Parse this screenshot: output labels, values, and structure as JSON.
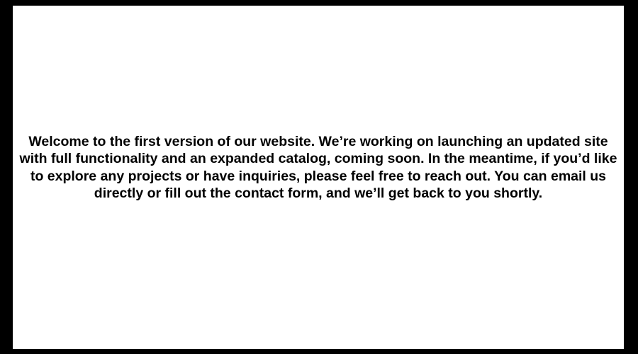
{
  "page": {
    "message": "Welcome to the first version of our website. We’re working on launching an updated site with full functionality and an expanded catalog, coming soon. In the meantime, if you’d like to explore any projects or have inquiries, please feel free to reach out. You can email us directly or fill out the contact form, and we’ll get back to you shortly."
  },
  "colors": {
    "frame": "#000000",
    "panel": "#ffffff",
    "text": "#000000"
  }
}
